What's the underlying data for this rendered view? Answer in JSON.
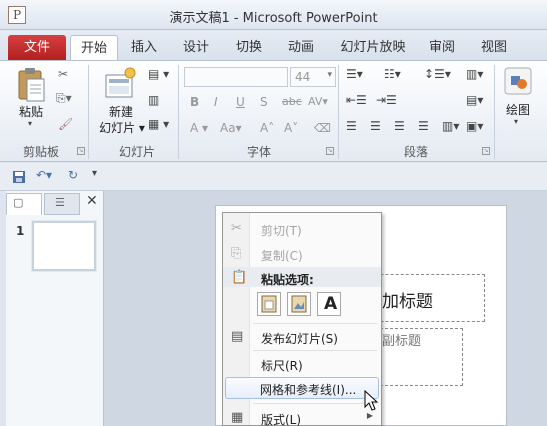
{
  "window": {
    "app_icon_letter": "P",
    "title": "演示文稿1 - Microsoft PowerPoint"
  },
  "tabs": [
    {
      "label": "文件"
    },
    {
      "label": "开始"
    },
    {
      "label": "插入"
    },
    {
      "label": "设计"
    },
    {
      "label": "切换"
    },
    {
      "label": "动画"
    },
    {
      "label": "幻灯片放映"
    },
    {
      "label": "审阅"
    },
    {
      "label": "视图"
    }
  ],
  "ribbon": {
    "clipboard": {
      "paste_label": "粘贴",
      "group_label": "剪贴板"
    },
    "slides": {
      "new_slide_line1": "新建",
      "new_slide_line2": "幻灯片",
      "group_label": "幻灯片"
    },
    "font": {
      "font_size": "44",
      "group_label": "字体"
    },
    "paragraph": {
      "group_label": "段落"
    },
    "drawing": {
      "label": "绘图"
    }
  },
  "slide_panel": {
    "thumb_number": "1"
  },
  "slide": {
    "title_placeholder": "加标题",
    "subtitle_placeholder": "副标题"
  },
  "context_menu": {
    "cut": "剪切(T)",
    "copy": "复制(C)",
    "paste_options": "粘贴选项:",
    "publish_slides": "发布幻灯片(S)",
    "ruler": "标尺(R)",
    "grid_guides": "网格和参考线(I)...",
    "layout": "版式(L)",
    "paste_text_glyph": "A"
  },
  "colors": {
    "file_tab": "#c42b2b",
    "hover_border": "#a8c0e0"
  }
}
